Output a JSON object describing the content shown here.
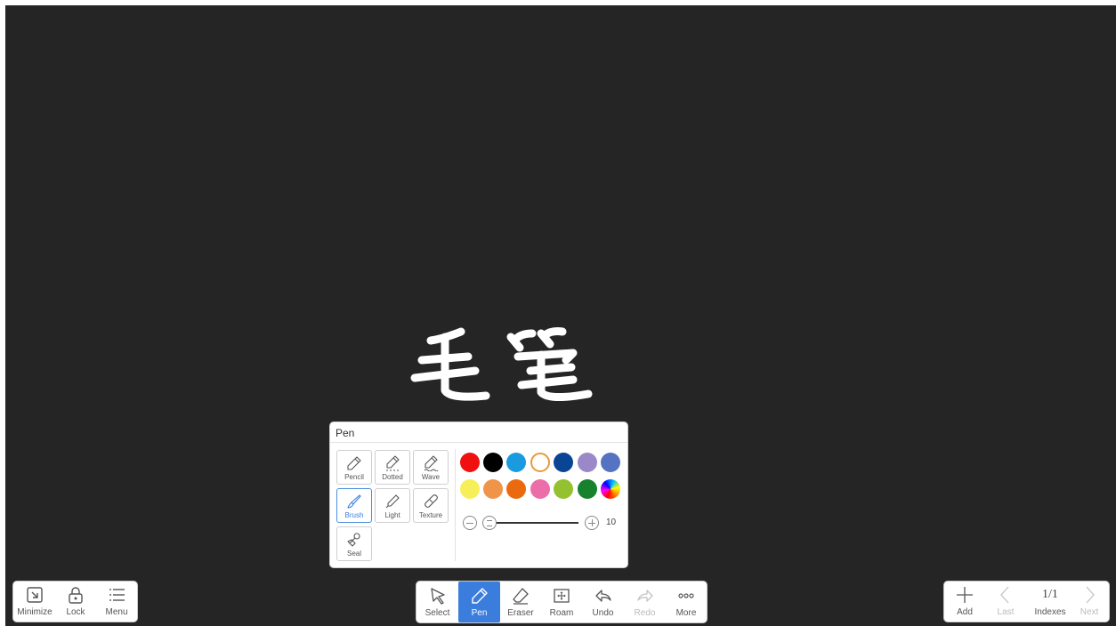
{
  "canvas": {
    "background": "#252525",
    "ink_color": "#ffffff",
    "ink_text": "毛笔"
  },
  "left_toolbar": {
    "items": [
      {
        "label": "Minimize",
        "icon": "minimize-icon"
      },
      {
        "label": "Lock",
        "icon": "lock-icon"
      },
      {
        "label": "Menu",
        "icon": "menu-icon"
      }
    ]
  },
  "main_toolbar": {
    "active_color": "#3b7ddd",
    "items": [
      {
        "label": "Select",
        "icon": "select-arrow-icon",
        "active": false,
        "enabled": true
      },
      {
        "label": "Pen",
        "icon": "pen-icon",
        "active": true,
        "enabled": true
      },
      {
        "label": "Eraser",
        "icon": "eraser-icon",
        "active": false,
        "enabled": true
      },
      {
        "label": "Roam",
        "icon": "roam-icon",
        "active": false,
        "enabled": true
      },
      {
        "label": "Undo",
        "icon": "undo-icon",
        "active": false,
        "enabled": true
      },
      {
        "label": "Redo",
        "icon": "redo-icon",
        "active": false,
        "enabled": false
      },
      {
        "label": "More",
        "icon": "more-icon",
        "active": false,
        "enabled": true
      }
    ]
  },
  "right_toolbar": {
    "items": [
      {
        "label": "Add",
        "icon": "plus-icon",
        "enabled": true
      },
      {
        "label": "Last",
        "icon": "chevron-left-icon",
        "enabled": false
      },
      {
        "label": "Indexes",
        "value": "1/1",
        "enabled": true
      },
      {
        "label": "Next",
        "icon": "chevron-right-icon",
        "enabled": false
      }
    ]
  },
  "pen_popup": {
    "title": "Pen",
    "pen_types": [
      {
        "label": "Pencil",
        "icon": "pencil-icon",
        "active": false
      },
      {
        "label": "Dotted",
        "icon": "dotted-pen-icon",
        "active": false
      },
      {
        "label": "Wave",
        "icon": "wave-pen-icon",
        "active": false
      },
      {
        "label": "Brush",
        "icon": "brush-icon",
        "active": true
      },
      {
        "label": "Light",
        "icon": "light-pen-icon",
        "active": false
      },
      {
        "label": "Texture",
        "icon": "texture-pen-icon",
        "active": false
      },
      {
        "label": "Seal",
        "icon": "seal-icon",
        "active": false
      }
    ],
    "colors_row1": [
      "#f01010",
      "#000000",
      "#1a9be0",
      "#ffffff",
      "#0a4595",
      "#9a88c8",
      "#5573c0"
    ],
    "colors_row2": [
      "#f7ef5a",
      "#f0944a",
      "#eb6a10",
      "#ec6ea8",
      "#93c130",
      "#18812e",
      "gradient"
    ],
    "selected_color_index": 3,
    "selected_ring_color": "#e89a3c",
    "size": {
      "value": "10",
      "fraction": 0.0
    }
  }
}
